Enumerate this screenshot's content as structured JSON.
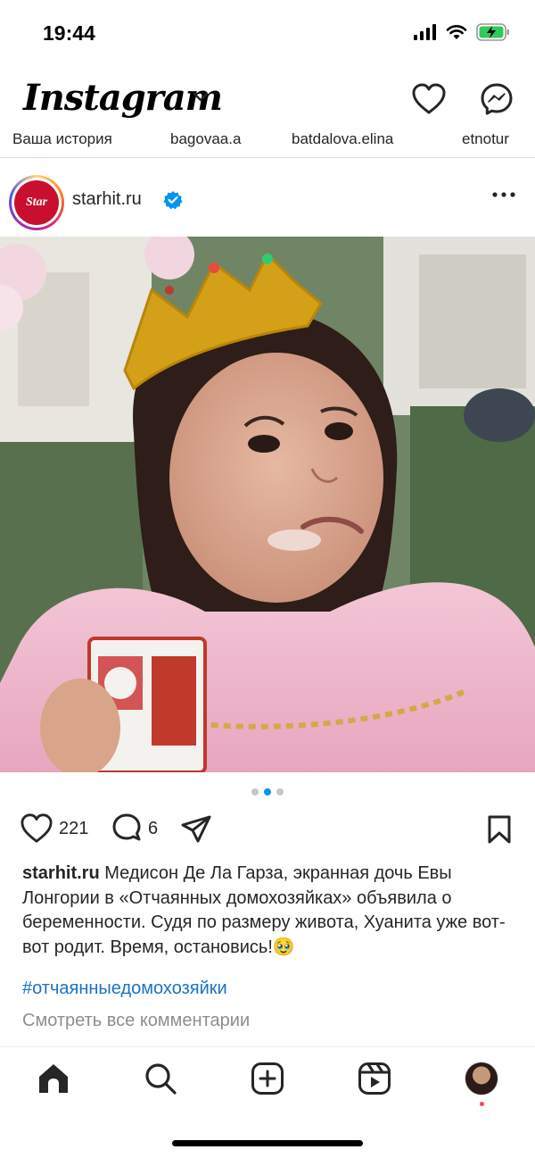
{
  "status_bar": {
    "time": "19:44"
  },
  "header": {
    "logo": "Instagram",
    "icons": [
      "chevron-down-icon",
      "heart-icon",
      "messenger-icon"
    ]
  },
  "stories": [
    {
      "label": "Ваша история"
    },
    {
      "label": "bagovaa.a"
    },
    {
      "label": "batdalova.elina"
    },
    {
      "label": "etnotur"
    }
  ],
  "post": {
    "username": "starhit.ru",
    "verified": true,
    "avatar_text": "Star",
    "carousel": {
      "total": 3,
      "active_index": 1
    },
    "likes": "221",
    "comments": "6",
    "caption_username": "starhit.ru",
    "caption_text": "Медисон Де Ла Гарза, экранная дочь Евы Лонгории в «Отчаянных домохозяйках» объявила о беременности. Судя по размеру живота, Хуанита уже вот-вот родит. Время, остановись!🥹",
    "hashtag": "#отчаянныедомохозяйки",
    "view_comments": "Смотреть все комментарии"
  },
  "bottom_nav": {
    "items": [
      "home-icon",
      "search-icon",
      "create-icon",
      "reels-icon",
      "profile-avatar"
    ],
    "active": "home-icon"
  },
  "colors": {
    "link": "#1a73c8",
    "verified": "#0095f6",
    "muted": "#8e8e8e",
    "notification": "#ed4956"
  }
}
